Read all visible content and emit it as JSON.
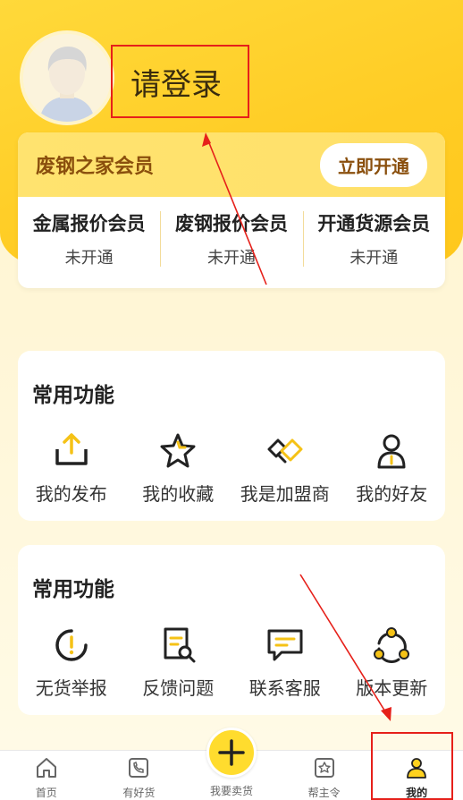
{
  "profile": {
    "login_text": "请登录",
    "avatar_icon": "user-avatar-icon"
  },
  "vip": {
    "title": "废钢之家会员",
    "button_label": "立即开通",
    "memberships": [
      {
        "name": "金属报价会员",
        "status": "未开通"
      },
      {
        "name": "废钢报价会员",
        "status": "未开通"
      },
      {
        "name": "开通货源会员",
        "status": "未开通"
      }
    ]
  },
  "functions1": {
    "title": "常用功能",
    "items": [
      {
        "label": "我的发布",
        "icon": "upload-icon"
      },
      {
        "label": "我的收藏",
        "icon": "star-icon"
      },
      {
        "label": "我是加盟商",
        "icon": "handshake-icon"
      },
      {
        "label": "我的好友",
        "icon": "person-icon"
      }
    ]
  },
  "functions2": {
    "title": "常用功能",
    "items": [
      {
        "label": "无货举报",
        "icon": "report-icon"
      },
      {
        "label": "反馈问题",
        "icon": "feedback-icon"
      },
      {
        "label": "联系客服",
        "icon": "chat-icon"
      },
      {
        "label": "版本更新",
        "icon": "update-icon"
      }
    ]
  },
  "tabbar": {
    "items": [
      {
        "label": "首页",
        "icon": "home-icon"
      },
      {
        "label": "有好货",
        "icon": "phone-icon"
      },
      {
        "label": "我要卖货",
        "icon": "plus-icon"
      },
      {
        "label": "帮主令",
        "icon": "star-box-icon"
      },
      {
        "label": "我的",
        "icon": "user-icon"
      }
    ],
    "active_index": 4
  },
  "colors": {
    "brand_yellow": "#ffcc24",
    "accent_brown": "#8a4f0d",
    "annotation_red": "#e6201a"
  }
}
